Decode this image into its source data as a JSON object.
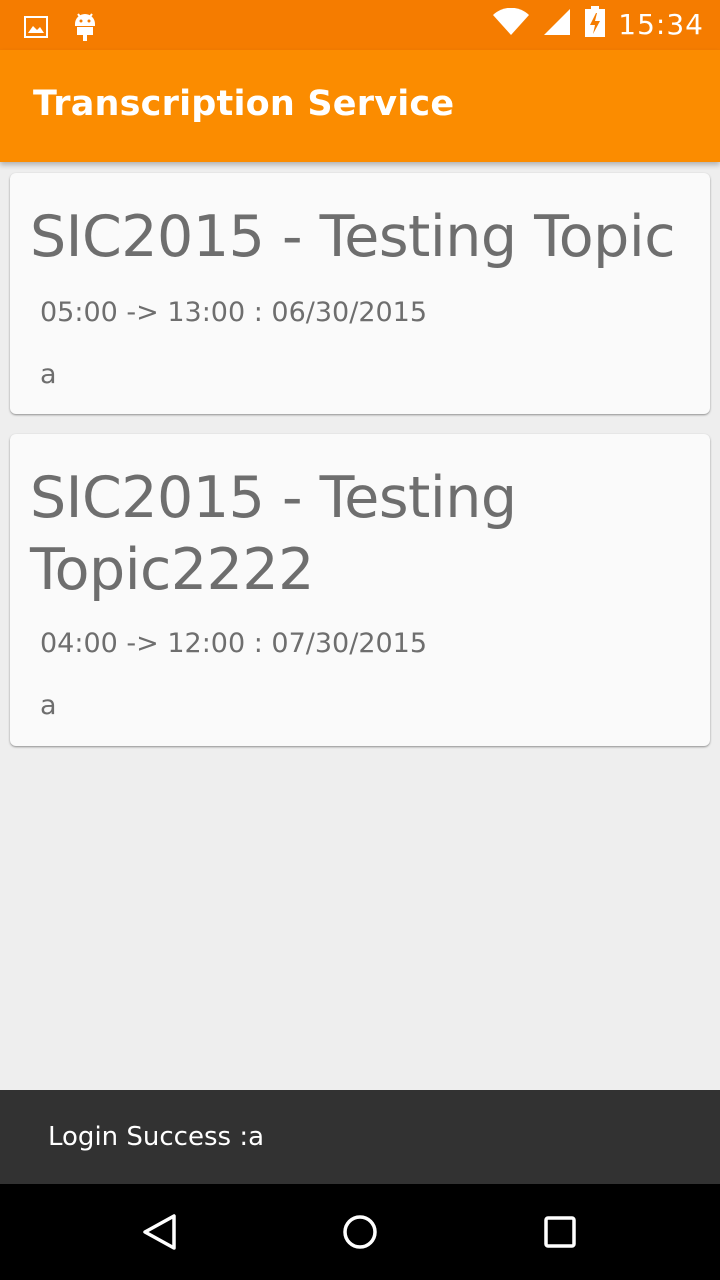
{
  "status_bar": {
    "time": "15:34",
    "icons": [
      "image-icon",
      "android-icon",
      "wifi-icon",
      "signal-icon",
      "battery-charging-icon"
    ]
  },
  "app_bar": {
    "title": "Transcription Service"
  },
  "cards": [
    {
      "title": "SIC2015 - Testing Topic",
      "time": "05:00 -> 13:00 : 06/30/2015",
      "subtitle": "a"
    },
    {
      "title": "SIC2015 - Testing Topic2222",
      "time": "04:00 -> 12:00 : 07/30/2015",
      "subtitle": "a"
    }
  ],
  "snackbar": {
    "message": "Login Success :a"
  },
  "nav_bar": {
    "icons": [
      "back-icon",
      "home-icon",
      "recent-apps-icon"
    ]
  },
  "colors": {
    "status_bar": "#F57C00",
    "app_bar": "#FB8C00",
    "background": "#EEEEEE",
    "card": "#FAFAFA",
    "snackbar": "#323232"
  }
}
